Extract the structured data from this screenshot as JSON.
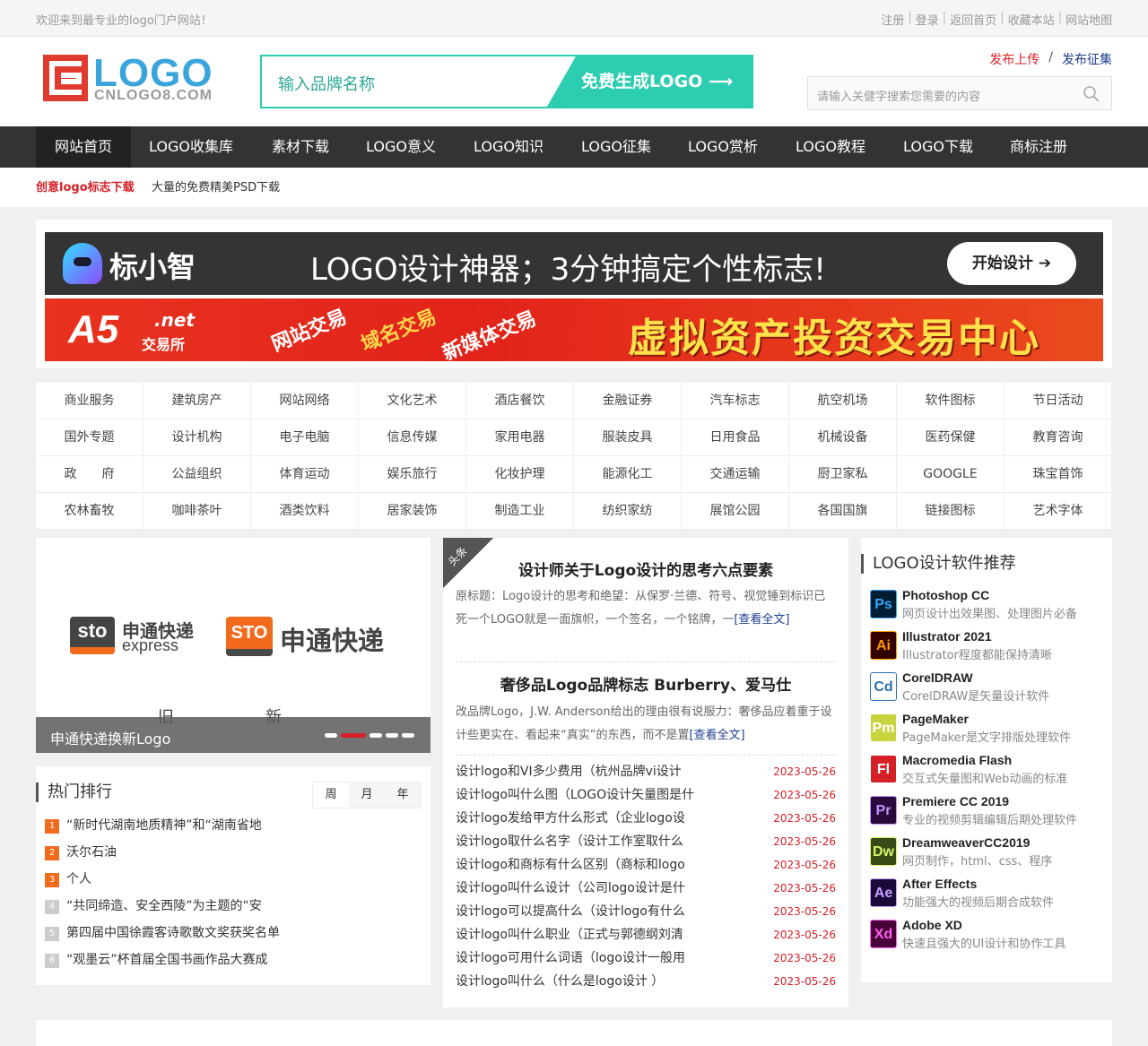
{
  "topbar": {
    "welcome": "欢迎来到最专业的logo门户网站！",
    "links": [
      "注册",
      "登录",
      "返回首页",
      "收藏本站",
      "网站地图"
    ]
  },
  "header": {
    "logo_word": "LOGO",
    "logo_sub": "CNLOGO8.COM",
    "brand_placeholder": "输入品牌名称",
    "brand_button": "免费生成LOGO ⟶",
    "publish_upload": "发布上传",
    "publish_separator": "/",
    "publish_collect": "发布征集",
    "search_placeholder": "请输入关健字搜索您需要的内容"
  },
  "nav": {
    "items": [
      "网站首页",
      "LOGO收集库",
      "素材下载",
      "LOGO意义",
      "LOGO知识",
      "LOGO征集",
      "LOGO赏析",
      "LOGO教程",
      "LOGO下载",
      "商标注册"
    ],
    "active": 0
  },
  "subbar": {
    "highlight": "创意logo标志下载",
    "text": "大量的免费精美PSD下载"
  },
  "banners": {
    "b1_name": "标小智",
    "b1_slogan": "LOGO设计神器；3分钟搞定个性标志!",
    "b1_cta": "开始设计 ➔",
    "b2_a5": "A5",
    "b2_net": ".net",
    "b2_jys": "交易所",
    "b2_t1": "网站交易",
    "b2_t2": "域名交易",
    "b2_t3": "新媒体交易",
    "b2_big": "虚拟资产投资交易中心"
  },
  "categories": [
    [
      "商业服务",
      "建筑房产",
      "网站网络",
      "文化艺术",
      "酒店餐饮",
      "金融证券",
      "汽车标志",
      "航空机场",
      "软件图标",
      "节日活动"
    ],
    [
      "国外专题",
      "设计机构",
      "电子电脑",
      "信息传媒",
      "家用电器",
      "服装皮具",
      "日用食品",
      "机械设备",
      "医药保健",
      "教育咨询"
    ],
    [
      "政　　府",
      "公益组织",
      "体育运动",
      "娱乐旅行",
      "化妆护理",
      "能源化工",
      "交通运输",
      "厨卫家私",
      "GOOGLE",
      "珠宝首饰"
    ],
    [
      "农林畜牧",
      "咖啡茶叶",
      "酒类饮料",
      "居家装饰",
      "制造工业",
      "纺织家纺",
      "展馆公园",
      "各国国旗",
      "链接图标",
      "艺术字体"
    ]
  ],
  "slider": {
    "sto_old": "sto",
    "cn_old": "申通快递",
    "en_old": "express",
    "sto_new": "STO",
    "cn_new": "申通快递",
    "label_old": "旧",
    "label_new": "新",
    "caption": "申通快递换新Logo",
    "dot_count": 5,
    "active_dot": 1
  },
  "hot": {
    "title": "热门排行",
    "tabs": [
      "周",
      "月",
      "年"
    ],
    "active_tab": 0,
    "items": [
      {
        "rank": "1",
        "text": "“新时代湖南地质精神”和“湖南省地"
      },
      {
        "rank": "2",
        "text": "沃尔石油"
      },
      {
        "rank": "3",
        "text": "个人"
      },
      {
        "rank": "4",
        "text": "“共同缔造、安全西陵”为主题的“安"
      },
      {
        "rank": "5",
        "text": "第四届中国徐霞客诗歌散文奖获奖名单"
      },
      {
        "rank": "6",
        "text": "“观墨云”杯首届全国书画作品大赛成"
      }
    ]
  },
  "headline": {
    "ribbon": "头条",
    "a1_title": "设计师关于Logo设计的思考六点要素",
    "a1_body": "原标题：Logo设计的思考和绝望：从保罗·兰德、符号、视觉锤到标识已死一个LOGO就是一面旗帜，一个签名，一个铭牌，一",
    "a1_more": "[查看全文]",
    "a2_title": "奢侈品Logo品牌标志 Burberry、爱马仕",
    "a2_body": "改品牌Logo，J.W. Anderson给出的理由很有说服力：奢侈品应着重于设计些更实在、看起来“真实”的东西，而不是置",
    "a2_more": "[查看全文]",
    "news": [
      {
        "title": "设计logo和VI多少费用（杭州品牌vi设计",
        "date": "2023-05-26"
      },
      {
        "title": "设计logo叫什么图（LOGO设计矢量图是什",
        "date": "2023-05-26"
      },
      {
        "title": "设计logo发给甲方什么形式（企业logo设",
        "date": "2023-05-26"
      },
      {
        "title": "设计logo取什么名字（设计工作室取什么",
        "date": "2023-05-26"
      },
      {
        "title": "设计logo和商标有什么区别（商标和logo",
        "date": "2023-05-26"
      },
      {
        "title": "设计logo叫什么设计（公司logo设计是什",
        "date": "2023-05-26"
      },
      {
        "title": "设计logo可以提高什么（设计logo有什么",
        "date": "2023-05-26"
      },
      {
        "title": "设计logo叫什么职业（正式与郭德纲刘清",
        "date": "2023-05-26"
      },
      {
        "title": "设计logo可用什么词语（logo设计一般用",
        "date": "2023-05-26"
      },
      {
        "title": "设计logo叫什么（什么是logo设计 ）",
        "date": "2023-05-26"
      }
    ]
  },
  "software": {
    "title": "LOGO设计软件推荐",
    "items": [
      {
        "icon": "Ps",
        "name": "Photoshop CC",
        "desc": "网页设计出效果图、处理图片必备",
        "bg": "#001d34",
        "fg": "#31a8ff"
      },
      {
        "icon": "Ai",
        "name": "Illustrator 2021",
        "desc": "Illustrator程度都能保持清晰",
        "bg": "#330000",
        "fg": "#ff9a00"
      },
      {
        "icon": "Cd",
        "name": "CorelDRAW",
        "desc": "CorelDRAW是矢量设计软件",
        "bg": "#ffffff",
        "fg": "#2a6fb5"
      },
      {
        "icon": "Pm",
        "name": "PageMaker",
        "desc": "PageMaker是文字排版处理软件",
        "bg": "#c8d43c",
        "fg": "#ffffff"
      },
      {
        "icon": "Fl",
        "name": "Macromedia Flash",
        "desc": "交互式矢量图和Web动画的标准",
        "bg": "#d62027",
        "fg": "#ffffff"
      },
      {
        "icon": "Pr",
        "name": "Premiere CC 2019",
        "desc": "专业的视频剪辑编辑后期处理软件",
        "bg": "#2a0a3a",
        "fg": "#c293ff"
      },
      {
        "icon": "Dw",
        "name": "DreamweaverCC2019",
        "desc": "网页制作，html、css、程序",
        "bg": "#3a4a17",
        "fg": "#d6f36b"
      },
      {
        "icon": "Ae",
        "name": "After Effects",
        "desc": "功能强大的视频后期合成软件",
        "bg": "#1a0a3a",
        "fg": "#c8a0ff"
      },
      {
        "icon": "Xd",
        "name": "Adobe XD",
        "desc": "快速且强大的UI设计和协作工具",
        "bg": "#470137",
        "fg": "#ff61f6"
      }
    ]
  },
  "colors": {
    "accent_red": "#d62027",
    "teal": "#2ccdb1",
    "nav_bg": "#333333"
  }
}
